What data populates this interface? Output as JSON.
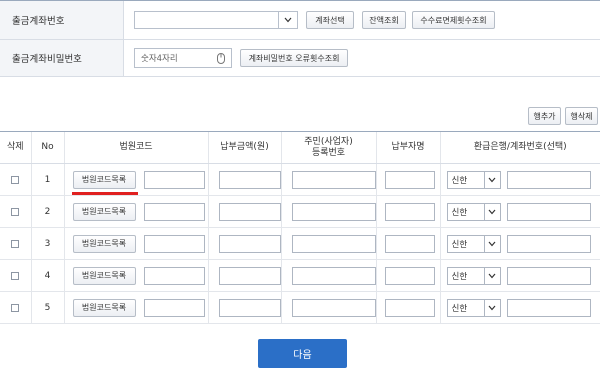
{
  "form": {
    "account_label": "출금계좌번호",
    "account_value": "",
    "account_select_button": "계좌선택",
    "balance_button": "잔액조회",
    "fee_exempt_button": "수수료면제횟수조회",
    "password_label": "출금계좌비밀번호",
    "password_placeholder": "숫자4자리",
    "password_error_button": "계좌비밀번호 오류횟수조회"
  },
  "row_actions": {
    "add": "행추가",
    "delete": "행삭제"
  },
  "table": {
    "headers": {
      "delete": "삭제",
      "no": "No",
      "court_code": "법원코드",
      "amount": "납부금액(원)",
      "resident_id_line1": "주민(사업자)",
      "resident_id_line2": "등록번호",
      "payer": "납부자명",
      "refund": "환급은행/계좌번호(선택)"
    },
    "rows": [
      {
        "no": "1",
        "court_button": "법원코드목록",
        "bank": "신한"
      },
      {
        "no": "2",
        "court_button": "법원코드목록",
        "bank": "신한"
      },
      {
        "no": "3",
        "court_button": "법원코드목록",
        "bank": "신한"
      },
      {
        "no": "4",
        "court_button": "법원코드목록",
        "bank": "신한"
      },
      {
        "no": "5",
        "court_button": "법원코드목록",
        "bank": "신한"
      }
    ]
  },
  "next_button": "다음",
  "icons": {
    "chevron": "chevron-down-icon",
    "keyboard": "mouse-keypad-icon"
  },
  "colors": {
    "primary": "#2b6fc7",
    "highlight": "#e02020"
  }
}
